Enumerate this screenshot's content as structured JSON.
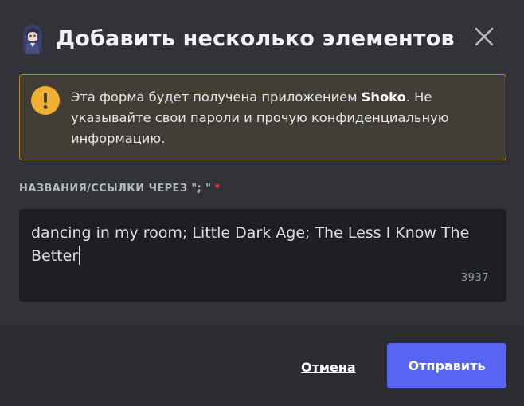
{
  "header": {
    "title": "Добавить несколько элементов",
    "avatar_icon": "anime-character-avatar",
    "close_icon": "close-icon"
  },
  "warning": {
    "text_before": "Эта форма будет получена приложением ",
    "app_name": "Shoko",
    "text_after": ". Не указывайте свои пароли и прочую конфиденциальную информацию.",
    "icon": "exclamation-circle-icon",
    "accent_color": "#f0b132"
  },
  "field": {
    "label": "НАЗВАНИЯ/ССЫЛКИ ЧЕРЕЗ \"; \"",
    "required_mark": "*",
    "value": "dancing in my room; Little Dark Age; The Less I Know The Better",
    "remaining_chars": "3937"
  },
  "footer": {
    "cancel_label": "Отмена",
    "submit_label": "Отправить"
  },
  "colors": {
    "primary_button": "#5865f2",
    "required": "#f23f43"
  }
}
